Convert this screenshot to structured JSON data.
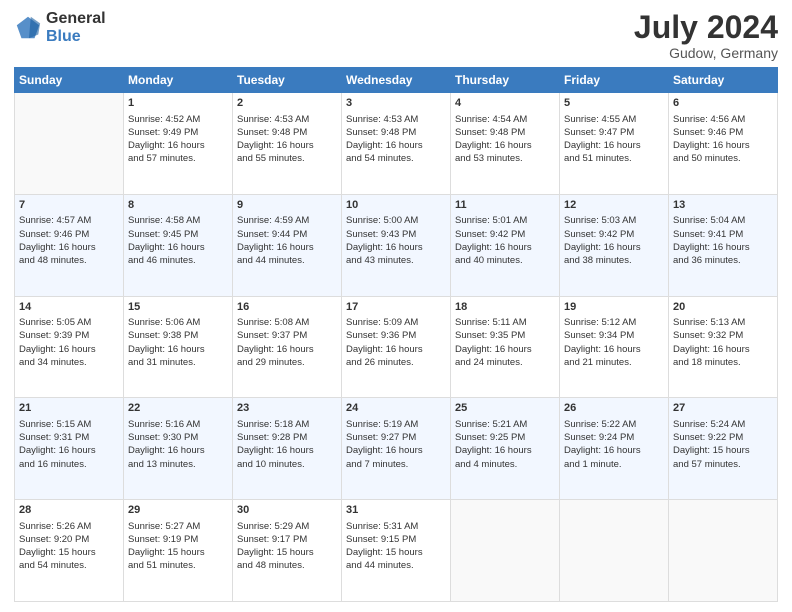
{
  "logo": {
    "general": "General",
    "blue": "Blue"
  },
  "title": {
    "month_year": "July 2024",
    "location": "Gudow, Germany"
  },
  "headers": [
    "Sunday",
    "Monday",
    "Tuesday",
    "Wednesday",
    "Thursday",
    "Friday",
    "Saturday"
  ],
  "rows": [
    [
      {
        "num": "",
        "lines": []
      },
      {
        "num": "1",
        "lines": [
          "Sunrise: 4:52 AM",
          "Sunset: 9:49 PM",
          "Daylight: 16 hours",
          "and 57 minutes."
        ]
      },
      {
        "num": "2",
        "lines": [
          "Sunrise: 4:53 AM",
          "Sunset: 9:48 PM",
          "Daylight: 16 hours",
          "and 55 minutes."
        ]
      },
      {
        "num": "3",
        "lines": [
          "Sunrise: 4:53 AM",
          "Sunset: 9:48 PM",
          "Daylight: 16 hours",
          "and 54 minutes."
        ]
      },
      {
        "num": "4",
        "lines": [
          "Sunrise: 4:54 AM",
          "Sunset: 9:48 PM",
          "Daylight: 16 hours",
          "and 53 minutes."
        ]
      },
      {
        "num": "5",
        "lines": [
          "Sunrise: 4:55 AM",
          "Sunset: 9:47 PM",
          "Daylight: 16 hours",
          "and 51 minutes."
        ]
      },
      {
        "num": "6",
        "lines": [
          "Sunrise: 4:56 AM",
          "Sunset: 9:46 PM",
          "Daylight: 16 hours",
          "and 50 minutes."
        ]
      }
    ],
    [
      {
        "num": "7",
        "lines": [
          "Sunrise: 4:57 AM",
          "Sunset: 9:46 PM",
          "Daylight: 16 hours",
          "and 48 minutes."
        ]
      },
      {
        "num": "8",
        "lines": [
          "Sunrise: 4:58 AM",
          "Sunset: 9:45 PM",
          "Daylight: 16 hours",
          "and 46 minutes."
        ]
      },
      {
        "num": "9",
        "lines": [
          "Sunrise: 4:59 AM",
          "Sunset: 9:44 PM",
          "Daylight: 16 hours",
          "and 44 minutes."
        ]
      },
      {
        "num": "10",
        "lines": [
          "Sunrise: 5:00 AM",
          "Sunset: 9:43 PM",
          "Daylight: 16 hours",
          "and 43 minutes."
        ]
      },
      {
        "num": "11",
        "lines": [
          "Sunrise: 5:01 AM",
          "Sunset: 9:42 PM",
          "Daylight: 16 hours",
          "and 40 minutes."
        ]
      },
      {
        "num": "12",
        "lines": [
          "Sunrise: 5:03 AM",
          "Sunset: 9:42 PM",
          "Daylight: 16 hours",
          "and 38 minutes."
        ]
      },
      {
        "num": "13",
        "lines": [
          "Sunrise: 5:04 AM",
          "Sunset: 9:41 PM",
          "Daylight: 16 hours",
          "and 36 minutes."
        ]
      }
    ],
    [
      {
        "num": "14",
        "lines": [
          "Sunrise: 5:05 AM",
          "Sunset: 9:39 PM",
          "Daylight: 16 hours",
          "and 34 minutes."
        ]
      },
      {
        "num": "15",
        "lines": [
          "Sunrise: 5:06 AM",
          "Sunset: 9:38 PM",
          "Daylight: 16 hours",
          "and 31 minutes."
        ]
      },
      {
        "num": "16",
        "lines": [
          "Sunrise: 5:08 AM",
          "Sunset: 9:37 PM",
          "Daylight: 16 hours",
          "and 29 minutes."
        ]
      },
      {
        "num": "17",
        "lines": [
          "Sunrise: 5:09 AM",
          "Sunset: 9:36 PM",
          "Daylight: 16 hours",
          "and 26 minutes."
        ]
      },
      {
        "num": "18",
        "lines": [
          "Sunrise: 5:11 AM",
          "Sunset: 9:35 PM",
          "Daylight: 16 hours",
          "and 24 minutes."
        ]
      },
      {
        "num": "19",
        "lines": [
          "Sunrise: 5:12 AM",
          "Sunset: 9:34 PM",
          "Daylight: 16 hours",
          "and 21 minutes."
        ]
      },
      {
        "num": "20",
        "lines": [
          "Sunrise: 5:13 AM",
          "Sunset: 9:32 PM",
          "Daylight: 16 hours",
          "and 18 minutes."
        ]
      }
    ],
    [
      {
        "num": "21",
        "lines": [
          "Sunrise: 5:15 AM",
          "Sunset: 9:31 PM",
          "Daylight: 16 hours",
          "and 16 minutes."
        ]
      },
      {
        "num": "22",
        "lines": [
          "Sunrise: 5:16 AM",
          "Sunset: 9:30 PM",
          "Daylight: 16 hours",
          "and 13 minutes."
        ]
      },
      {
        "num": "23",
        "lines": [
          "Sunrise: 5:18 AM",
          "Sunset: 9:28 PM",
          "Daylight: 16 hours",
          "and 10 minutes."
        ]
      },
      {
        "num": "24",
        "lines": [
          "Sunrise: 5:19 AM",
          "Sunset: 9:27 PM",
          "Daylight: 16 hours",
          "and 7 minutes."
        ]
      },
      {
        "num": "25",
        "lines": [
          "Sunrise: 5:21 AM",
          "Sunset: 9:25 PM",
          "Daylight: 16 hours",
          "and 4 minutes."
        ]
      },
      {
        "num": "26",
        "lines": [
          "Sunrise: 5:22 AM",
          "Sunset: 9:24 PM",
          "Daylight: 16 hours",
          "and 1 minute."
        ]
      },
      {
        "num": "27",
        "lines": [
          "Sunrise: 5:24 AM",
          "Sunset: 9:22 PM",
          "Daylight: 15 hours",
          "and 57 minutes."
        ]
      }
    ],
    [
      {
        "num": "28",
        "lines": [
          "Sunrise: 5:26 AM",
          "Sunset: 9:20 PM",
          "Daylight: 15 hours",
          "and 54 minutes."
        ]
      },
      {
        "num": "29",
        "lines": [
          "Sunrise: 5:27 AM",
          "Sunset: 9:19 PM",
          "Daylight: 15 hours",
          "and 51 minutes."
        ]
      },
      {
        "num": "30",
        "lines": [
          "Sunrise: 5:29 AM",
          "Sunset: 9:17 PM",
          "Daylight: 15 hours",
          "and 48 minutes."
        ]
      },
      {
        "num": "31",
        "lines": [
          "Sunrise: 5:31 AM",
          "Sunset: 9:15 PM",
          "Daylight: 15 hours",
          "and 44 minutes."
        ]
      },
      {
        "num": "",
        "lines": []
      },
      {
        "num": "",
        "lines": []
      },
      {
        "num": "",
        "lines": []
      }
    ]
  ]
}
